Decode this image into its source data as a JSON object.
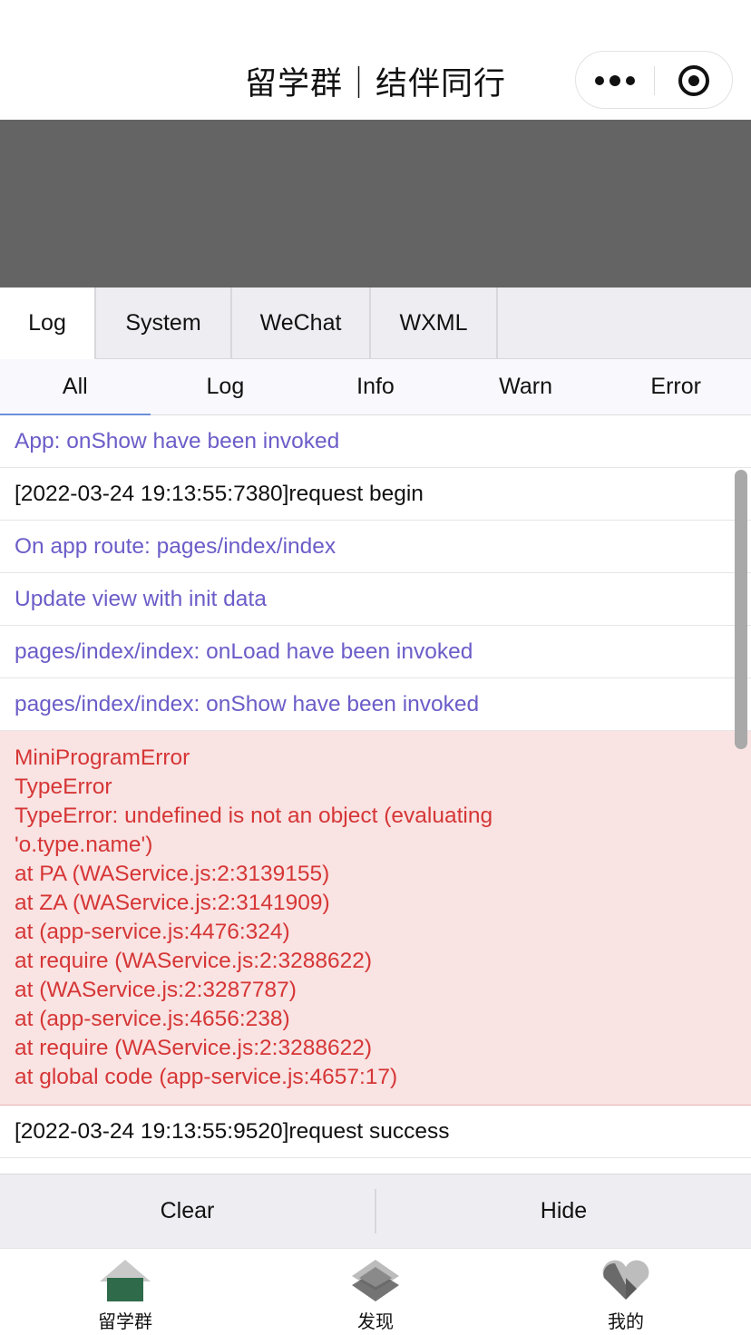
{
  "navbar": {
    "title": "留学群｜结伴同行"
  },
  "console": {
    "tabs": [
      "Log",
      "System",
      "WeChat",
      "WXML"
    ],
    "active_tab": "Log",
    "filters": [
      "All",
      "Log",
      "Info",
      "Warn",
      "Error"
    ],
    "active_filter": "All",
    "logs": [
      {
        "type": "info",
        "text": "App: onShow have been invoked"
      },
      {
        "type": "plain",
        "text": "[2022-03-24 19:13:55:7380]request begin"
      },
      {
        "type": "info",
        "text": "On app route: pages/index/index"
      },
      {
        "type": "info",
        "text": "Update view with init data"
      },
      {
        "type": "info",
        "text": "pages/index/index: onLoad have been invoked"
      },
      {
        "type": "info",
        "text": "pages/index/index: onShow have been invoked"
      }
    ],
    "error": {
      "lines": [
        "MiniProgramError",
        "TypeError",
        "TypeError: undefined is not an object (evaluating",
        "'o.type.name')",
        "at PA (WAService.js:2:3139155)",
        "at ZA (WAService.js:2:3141909)",
        "at (app-service.js:4476:324)",
        "at require (WAService.js:2:3288622)",
        "at (WAService.js:2:3287787)",
        "at (app-service.js:4656:238)",
        "at require (WAService.js:2:3288622)",
        "at global code (app-service.js:4657:17)"
      ]
    },
    "after_error": [
      {
        "type": "plain",
        "text": "[2022-03-24 19:13:55:9520]request success"
      }
    ],
    "buttons": {
      "clear": "Clear",
      "hide": "Hide"
    }
  },
  "tabbar": {
    "items": [
      {
        "label": "留学群",
        "icon": "home-icon"
      },
      {
        "label": "发现",
        "icon": "layers-icon"
      },
      {
        "label": "我的",
        "icon": "heart-icon"
      }
    ]
  },
  "colors": {
    "info_text": "#6b5dc8",
    "error_text": "#d63636",
    "error_bg": "#f9e3e3",
    "banner": "#646464",
    "home_icon_green": "#2f6b4a"
  }
}
